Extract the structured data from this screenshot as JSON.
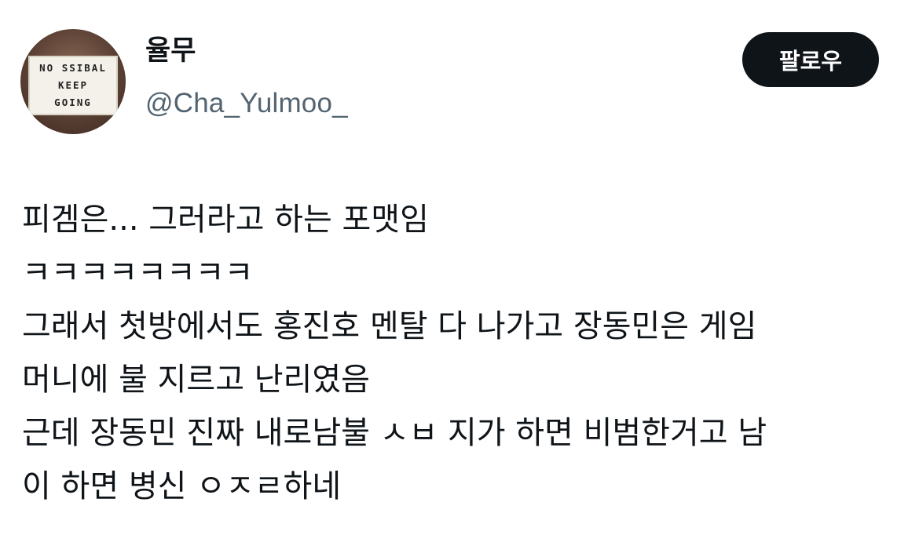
{
  "profile": {
    "display_name": "율무",
    "handle": "@Cha_Yulmoo_",
    "avatar_text": [
      "NO SSIBAL",
      "KEEP",
      "GOING"
    ]
  },
  "follow_button": {
    "label": "팔로우"
  },
  "tweet": {
    "lines": [
      "피겜은... 그러라고 하는 포맷임",
      "ㅋㅋㅋㅋㅋㅋㅋㅋ",
      "그래서 첫방에서도 홍진호 멘탈 다 나가고 장동민은 게임",
      "머니에 불 지르고 난리였음",
      "근데 장동민 진짜 내로남불 ㅅㅂ 지가 하면 비범한거고 남",
      "이 하면 병신 ㅇㅈㄹ하네"
    ]
  },
  "colors": {
    "text_primary": "#0f1419",
    "text_secondary": "#536471",
    "button_bg": "#0f1419",
    "button_text": "#ffffff"
  }
}
